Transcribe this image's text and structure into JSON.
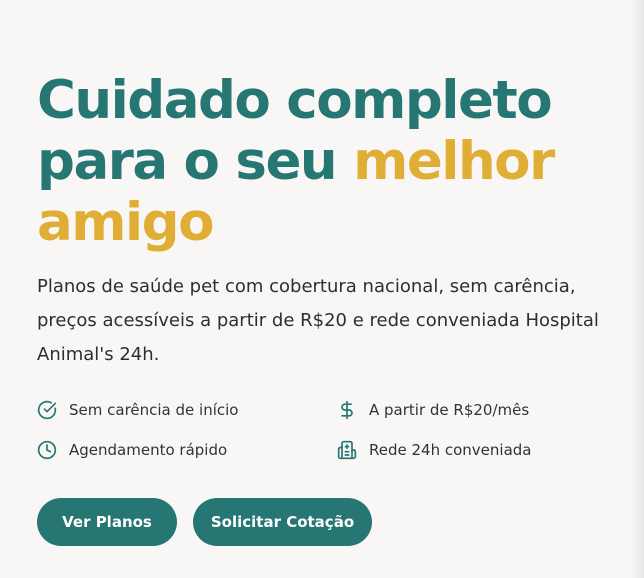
{
  "hero": {
    "headline": {
      "part1": "Cuidado completo para o seu ",
      "accent": "melhor amigo"
    },
    "lead": "Planos de saúde pet com cobertura nacional, sem carência, preços acessíveis a partir de R$20 e rede conveniada Hospital Animal's 24h."
  },
  "features": [
    {
      "label": "Sem carência de início",
      "icon": "check-circle-icon"
    },
    {
      "label": "A partir de R$20/mês",
      "icon": "dollar-icon"
    },
    {
      "label": "Agendamento rápido",
      "icon": "clock-icon"
    },
    {
      "label": "Rede 24h conveniada",
      "icon": "hospital-icon"
    }
  ],
  "actions": {
    "primary_label": "Ver Planos",
    "secondary_label": "Solicitar Cotação"
  },
  "colors": {
    "brand_teal": "#267674",
    "accent_gold": "#e0ae35",
    "background": "#f9f7f5",
    "text": "#2e2e2e"
  }
}
